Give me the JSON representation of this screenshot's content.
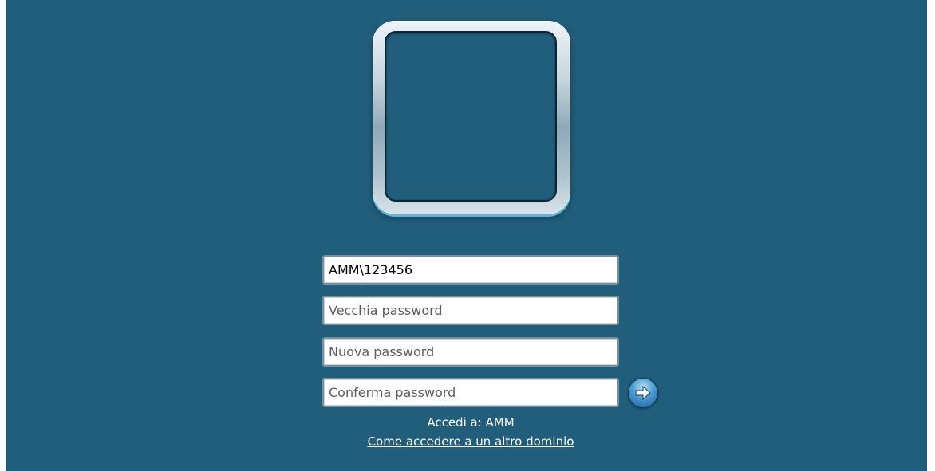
{
  "login": {
    "username_value": "AMM\\123456",
    "old_password_placeholder": "Vecchia password",
    "new_password_placeholder": "Nuova password",
    "confirm_password_placeholder": "Conferma password",
    "domain_label": "Accedi a: AMM",
    "other_domain_link": "Come accedere a un altro dominio",
    "submit_icon": "arrow-right-icon"
  },
  "colors": {
    "background": "#215e7c",
    "text": "#ffffff"
  }
}
